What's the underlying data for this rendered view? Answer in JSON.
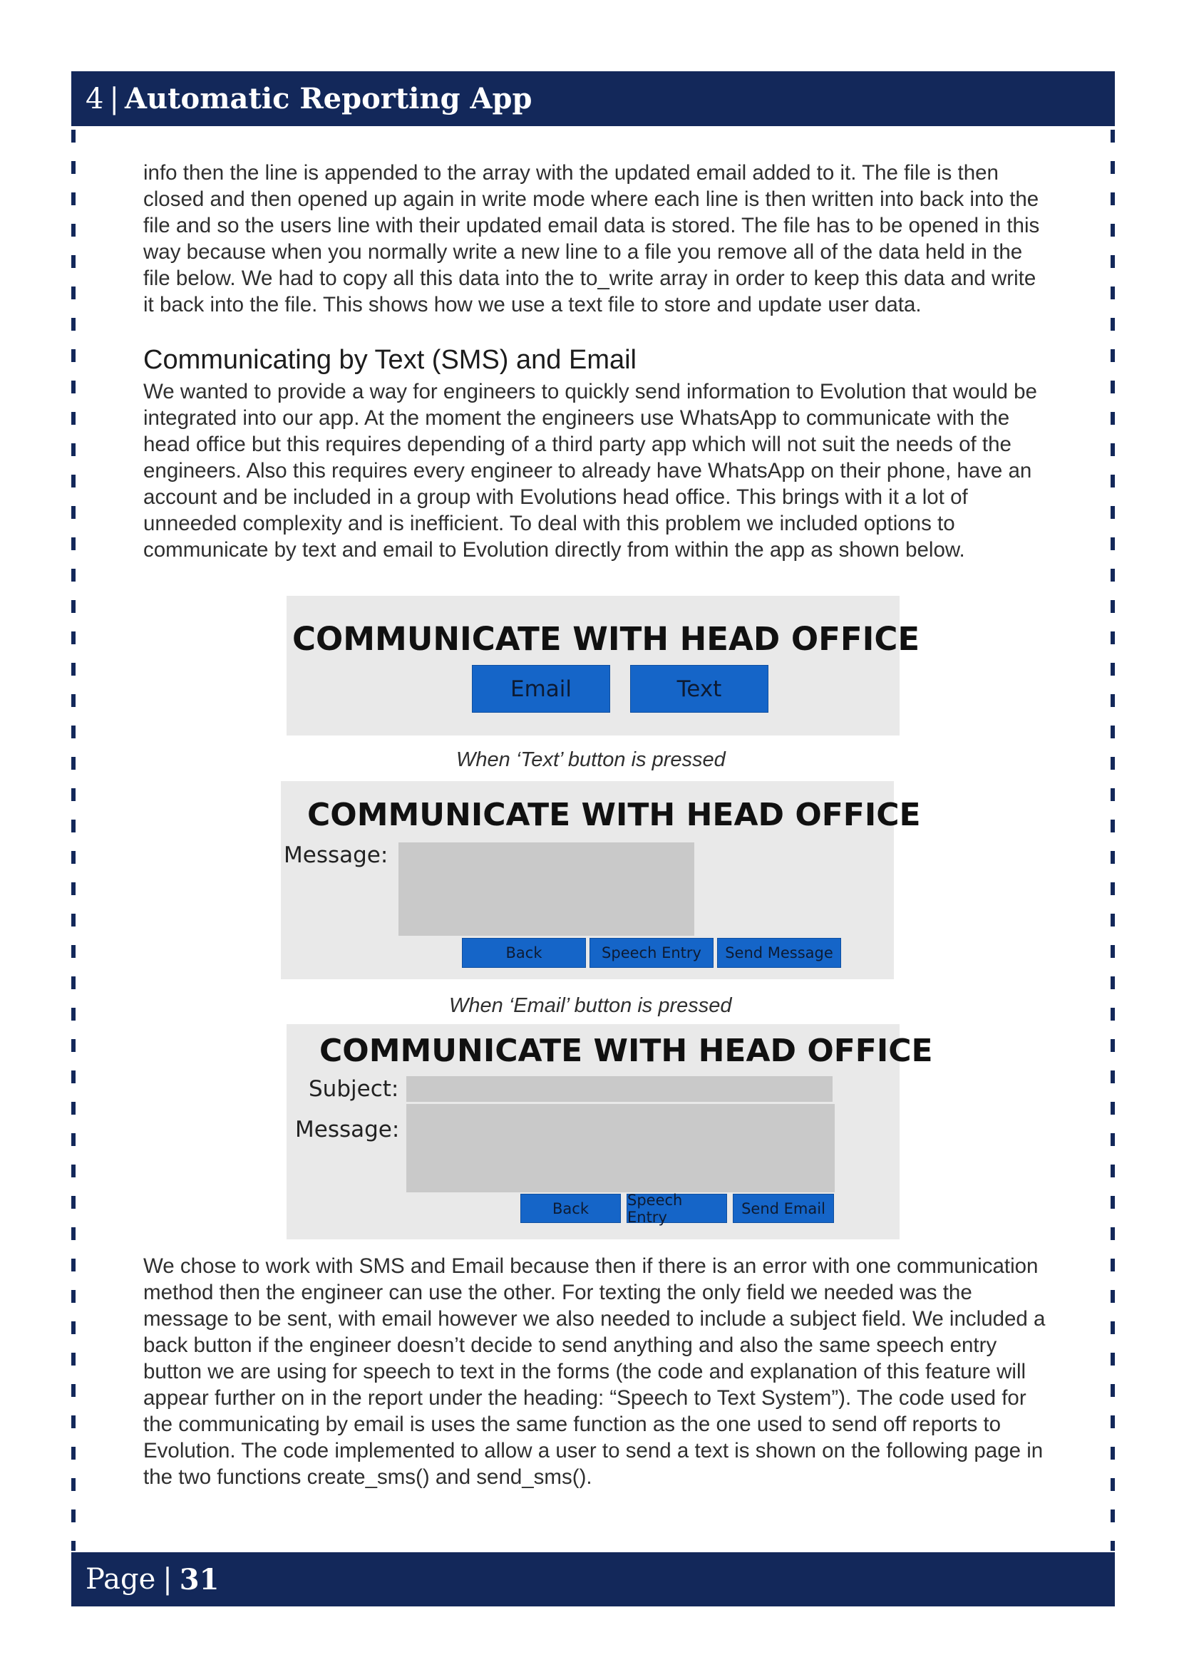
{
  "header": {
    "chapter_number": "4",
    "separator": "|",
    "title": "Automatic Reporting App"
  },
  "footer": {
    "page_label": "Page",
    "separator": "|",
    "page_number": "31"
  },
  "paragraph_1": "info then the line is appended to the array with the updated email added to it. The file is then closed and then opened up again in write mode where each line is then written into back into the file and so the users line with their updated email data is stored. The file has to be opened in this way because when you normally write a new line to a file you remove all of the data held in the file below. We had to copy all this data into the to_write array in order to keep this data and write it back into the file. This shows how we use a text file to store and update user data.",
  "section_heading": "Communicating by Text (SMS) and Email",
  "paragraph_2": "We wanted to provide a way for engineers to quickly send information to Evolution that would be integrated into our app. At the moment the engineers use WhatsApp to communicate with the head office but this requires depending of a third party app which will not suit the needs of the engineers. Also this requires every engineer to already have WhatsApp on their phone, have an account and be included in a group with Evolutions head office. This brings with it a lot of unneeded complexity and is inefficient. To deal with this problem we included options to communicate by text and email to Evolution directly from within the app as shown below.",
  "screenshot_1": {
    "title": "COMMUNICATE WITH HEAD OFFICE",
    "email_button": "Email",
    "text_button": "Text"
  },
  "caption_1": "When ‘Text’ button is pressed",
  "screenshot_2": {
    "title": "COMMUNICATE WITH HEAD OFFICE",
    "message_label": "Message:",
    "back_button": "Back",
    "speech_button": "Speech Entry",
    "send_button": "Send Message"
  },
  "caption_2": "When ‘Email’ button is pressed",
  "screenshot_3": {
    "title": "COMMUNICATE WITH HEAD OFFICE",
    "subject_label": "Subject:",
    "message_label": "Message:",
    "back_button": "Back",
    "speech_button": "Speech Entry",
    "send_button": "Send Email"
  },
  "paragraph_3": "We chose to work with SMS and Email because then if there is an error with one communication method then the engineer can use the other. For texting the only field we needed was the message to be sent, with email however we also needed to include a subject field. We included a back button if the engineer doesn’t decide to send anything and also the same speech entry button we are using for speech to text in the forms (the code and explanation of this feature will appear further on in the report under the heading: “Speech to Text System”). The code used for the communicating by email is uses the same function as the one used to send off reports to Evolution.  The code implemented to allow a user to send a text is shown on the following page in the two functions create_sms() and send_sms().",
  "colors": {
    "navy": "#13285a",
    "button_blue": "#1565c8",
    "panel_grey": "#e9e9e9",
    "field_grey": "#c9c9c9"
  }
}
